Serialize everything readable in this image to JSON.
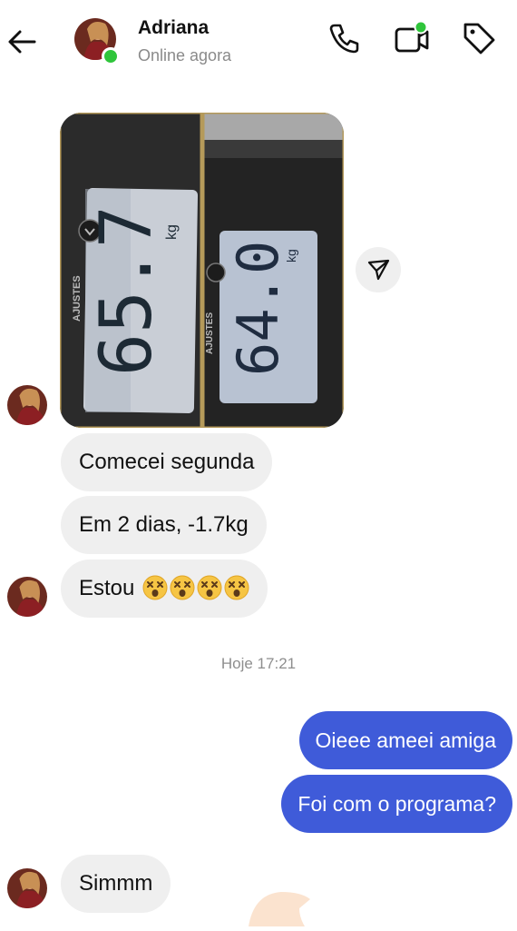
{
  "header": {
    "contact_name": "Adriana",
    "status": "Online agora",
    "icons": [
      "back-arrow-icon",
      "phone-icon",
      "video-call-icon",
      "tag-icon"
    ],
    "online_color": "#2fc53b"
  },
  "image_message": {
    "photo_1": {
      "display": "65.7",
      "unit": "kg",
      "button_label": "AJUSTES"
    },
    "photo_2": {
      "display": "64.0",
      "unit": "kg",
      "button_label": "AJUSTES"
    }
  },
  "messages_in": [
    {
      "text": "Comecei segunda"
    },
    {
      "text": "Em 2 dias, -1.7kg"
    },
    {
      "text": "Estou",
      "emoji": [
        "dizzy-face-emoji",
        "dizzy-face-emoji",
        "dizzy-face-emoji",
        "dizzy-face-emoji"
      ]
    }
  ],
  "timestamp": "Hoje 17:21",
  "messages_out": [
    {
      "text": "Oieee ameei amiga"
    },
    {
      "text": "Foi com o programa?"
    }
  ],
  "last_message_in": {
    "text": "Simmm"
  },
  "colors": {
    "outgoing_bubble": "#3f5bd9",
    "incoming_bubble": "#efefef",
    "timestamp_text": "#8e8e8e"
  }
}
